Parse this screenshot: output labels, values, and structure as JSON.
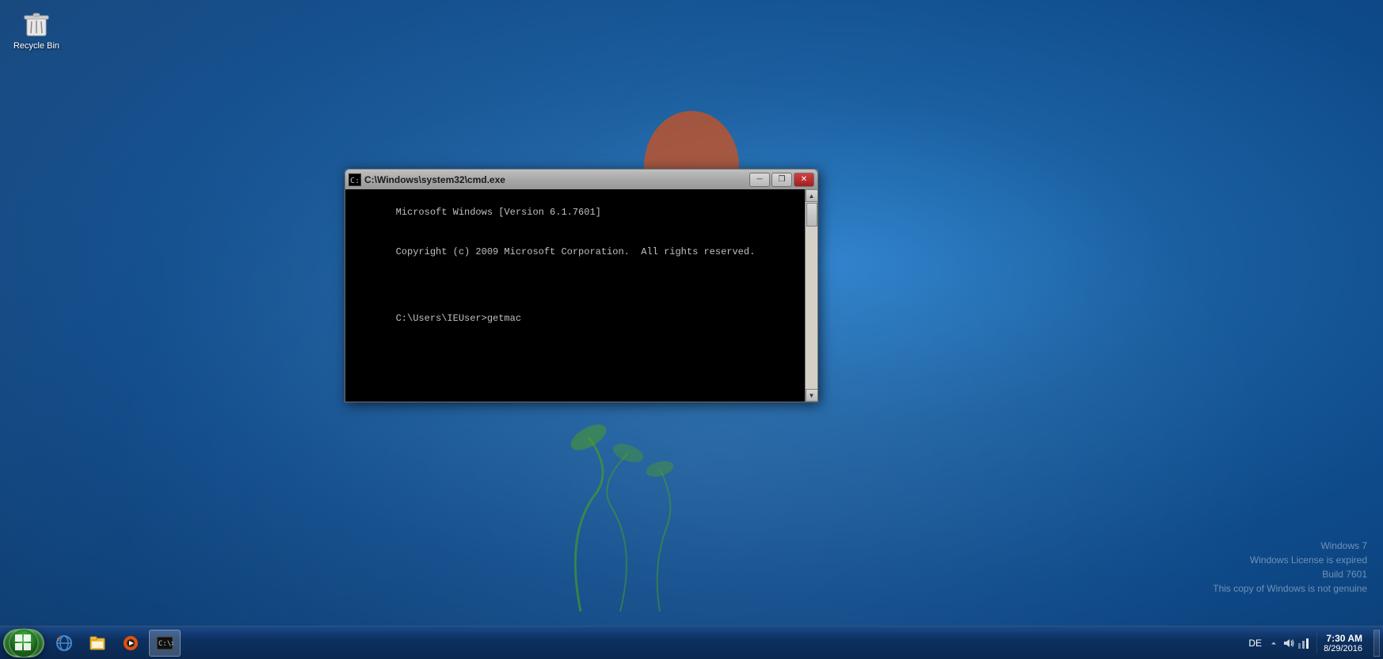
{
  "desktop": {
    "background_color": "#1a5fa0"
  },
  "recycle_bin": {
    "label": "Recycle Bin"
  },
  "cmd_window": {
    "title": "C:\\Windows\\system32\\cmd.exe",
    "line1": "Microsoft Windows [Version 6.1.7601]",
    "line2": "Copyright (c) 2009 Microsoft Corporation.  All rights reserved.",
    "line3": "",
    "line4": "C:\\Users\\IEUser>getmac"
  },
  "taskbar": {
    "start_label": "",
    "items": [
      {
        "name": "internet-explorer",
        "label": "Internet Explorer"
      },
      {
        "name": "windows-explorer",
        "label": "Windows Explorer"
      },
      {
        "name": "media-player",
        "label": "Windows Media Player"
      },
      {
        "name": "cmd",
        "label": "C:\\Windows\\system32\\cmd.exe",
        "active": true
      }
    ],
    "tray": {
      "language": "DE",
      "time": "7:30 AM",
      "date": "8/29/2016"
    }
  },
  "watermark": {
    "line1": "Windows 7",
    "line2": "Windows License is expired",
    "line3": "Build 7601",
    "line4": "This copy of Windows is not genuine"
  },
  "controls": {
    "minimize": "─",
    "restore": "❒",
    "close": "✕"
  }
}
